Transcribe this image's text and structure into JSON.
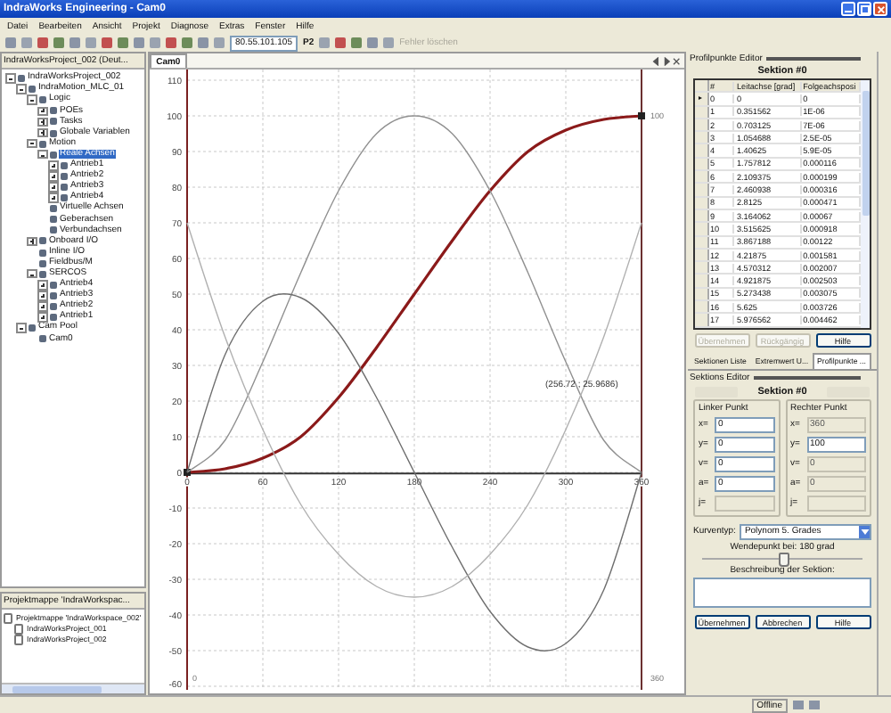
{
  "window": {
    "title": "IndraWorks Engineering - Cam0"
  },
  "menu": [
    "Datei",
    "Bearbeiten",
    "Ansicht",
    "Projekt",
    "Diagnose",
    "Extras",
    "Fenster",
    "Hilfe"
  ],
  "toolbar": {
    "address": "80.55.101.105",
    "p_label": "P2",
    "clear_button": {
      "label": "Fehler löschen",
      "disabled": true
    }
  },
  "project_panel": {
    "title": "IndraWorksProject_002 (Deut...",
    "tree": [
      {
        "label": "IndraWorksProject_002",
        "expanded": true,
        "selected": false,
        "children": [
          {
            "label": "IndraMotion_MLC_01",
            "expanded": true,
            "selected": false,
            "children": [
              {
                "label": "Logic",
                "expanded": true,
                "selected": false,
                "children": [
                  {
                    "label": "POEs",
                    "expanded": false,
                    "selected": false
                  },
                  {
                    "label": "Tasks",
                    "expanded": false,
                    "selected": false
                  },
                  {
                    "label": "Globale Variablen",
                    "expanded": false,
                    "selected": false
                  }
                ]
              },
              {
                "label": "Motion",
                "expanded": true,
                "selected": false,
                "children": [
                  {
                    "label": "Reale Achsen",
                    "expanded": true,
                    "selected": true,
                    "children": [
                      {
                        "label": "Antrieb1",
                        "expanded": false,
                        "selected": false
                      },
                      {
                        "label": "Antrieb2",
                        "expanded": false,
                        "selected": false
                      },
                      {
                        "label": "Antrieb3",
                        "expanded": false,
                        "selected": false
                      },
                      {
                        "label": "Antrieb4",
                        "expanded": false,
                        "selected": false
                      }
                    ]
                  },
                  {
                    "label": "Virtuelle Achsen",
                    "selected": false
                  },
                  {
                    "label": "Geberachsen",
                    "selected": false
                  },
                  {
                    "label": "Verbundachsen",
                    "selected": false
                  }
                ]
              },
              {
                "label": "Onboard I/O",
                "expanded": false,
                "selected": false
              },
              {
                "label": "Inline I/O",
                "selected": false
              },
              {
                "label": "Fieldbus/M",
                "selected": false
              },
              {
                "label": "SERCOS",
                "expanded": true,
                "selected": false,
                "children": [
                  {
                    "label": "Antrieb4",
                    "expanded": false,
                    "selected": false
                  },
                  {
                    "label": "Antrieb3",
                    "expanded": false,
                    "selected": false
                  },
                  {
                    "label": "Antrieb2",
                    "expanded": false,
                    "selected": false
                  },
                  {
                    "label": "Antrieb1",
                    "expanded": false,
                    "selected": false
                  }
                ]
              }
            ]
          },
          {
            "label": "Cam Pool",
            "expanded": true,
            "selected": false,
            "children": [
              {
                "label": "Cam0",
                "selected": false
              }
            ]
          }
        ]
      }
    ]
  },
  "solution_panel": {
    "title": "Projektmappe 'IndraWorkspac...",
    "tree": [
      {
        "label": "Projektmappe 'IndraWorkspace_002'",
        "selected": false,
        "children": [
          {
            "label": "IndraWorksProject_001",
            "selected": false
          },
          {
            "label": "IndraWorksProject_002",
            "selected": false
          }
        ]
      }
    ]
  },
  "editor_tab": {
    "label": "Cam0"
  },
  "chart_data": {
    "type": "line",
    "grid": true,
    "x": [
      0,
      30,
      60,
      90,
      120,
      150,
      180,
      210,
      240,
      270,
      300,
      330,
      360
    ],
    "series": [
      {
        "color": "#8b1a1a",
        "values": [
          0,
          1,
          4,
          10,
          21,
          35,
          50,
          65,
          79,
          90,
          96,
          99,
          100
        ]
      },
      {
        "color": "#909090",
        "values": [
          0,
          9,
          31,
          56,
          79,
          95,
          100,
          95,
          79,
          56,
          31,
          9,
          0
        ]
      },
      {
        "color": "#6e6e6e",
        "values": [
          0,
          33,
          48,
          49,
          39,
          21,
          0,
          -21,
          -39,
          -49,
          -48,
          -33,
          0
        ]
      },
      {
        "color": "#b0b0b0",
        "values": [
          70,
          38,
          12,
          -9,
          -23,
          -32,
          -35,
          -32,
          -23,
          -9,
          12,
          38,
          70
        ]
      }
    ],
    "xlim": [
      0,
      360
    ],
    "ylim": [
      -61,
      113
    ],
    "ref_lines": [
      {
        "axis": "x",
        "value": 360
      }
    ],
    "xticks": [
      0,
      60,
      120,
      180,
      240,
      300,
      360
    ],
    "yticks": [
      -60,
      -50,
      -40,
      -30,
      -20,
      -10,
      0,
      10,
      20,
      30,
      40,
      50,
      60,
      70,
      80,
      90,
      100,
      110
    ]
  },
  "chart_labels": {
    "readout": "(256.72 ; 25.9686)",
    "end_value": "100",
    "range_start": "0",
    "range_end": "360"
  },
  "profile_editor": {
    "title": "Profilpunkte Editor",
    "section": "Sektion #0",
    "columns": [
      "#",
      "Leitachse [grad]",
      "Folgeachsposi"
    ],
    "rows": [
      {
        "current": true,
        "cells": [
          "0",
          "0",
          "0"
        ]
      },
      {
        "current": false,
        "cells": [
          "1",
          "0.351562",
          "1E-06"
        ]
      },
      {
        "current": false,
        "cells": [
          "2",
          "0.703125",
          "7E-06"
        ]
      },
      {
        "current": false,
        "cells": [
          "3",
          "1.054688",
          "2.5E-05"
        ]
      },
      {
        "current": false,
        "cells": [
          "4",
          "1.40625",
          "5.9E-05"
        ]
      },
      {
        "current": false,
        "cells": [
          "5",
          "1.757812",
          "0.000116"
        ]
      },
      {
        "current": false,
        "cells": [
          "6",
          "2.109375",
          "0.000199"
        ]
      },
      {
        "current": false,
        "cells": [
          "7",
          "2.460938",
          "0.000316"
        ]
      },
      {
        "current": false,
        "cells": [
          "8",
          "2.8125",
          "0.000471"
        ]
      },
      {
        "current": false,
        "cells": [
          "9",
          "3.164062",
          "0.00067"
        ]
      },
      {
        "current": false,
        "cells": [
          "10",
          "3.515625",
          "0.000918"
        ]
      },
      {
        "current": false,
        "cells": [
          "11",
          "3.867188",
          "0.00122"
        ]
      },
      {
        "current": false,
        "cells": [
          "12",
          "4.21875",
          "0.001581"
        ]
      },
      {
        "current": false,
        "cells": [
          "13",
          "4.570312",
          "0.002007"
        ]
      },
      {
        "current": false,
        "cells": [
          "14",
          "4.921875",
          "0.002503"
        ]
      },
      {
        "current": false,
        "cells": [
          "15",
          "5.273438",
          "0.003075"
        ]
      },
      {
        "current": false,
        "cells": [
          "16",
          "5.625",
          "0.003726"
        ]
      },
      {
        "current": false,
        "cells": [
          "17",
          "5.976562",
          "0.004462"
        ]
      }
    ],
    "buttons": [
      {
        "label": "Übernehmen",
        "disabled": true
      },
      {
        "label": "Rückgängig",
        "disabled": true
      },
      {
        "label": "Hilfe",
        "disabled": false
      }
    ]
  },
  "tabs": [
    {
      "label": "Sektionen Liste",
      "selected": false
    },
    {
      "label": "Extremwert U...",
      "selected": false
    },
    {
      "label": "Profilpunkte ...",
      "selected": true
    }
  ],
  "section_editor": {
    "title": "Sektions Editor",
    "section": "Sektion #0",
    "groups": [
      {
        "title": "Linker Punkt",
        "fields": [
          {
            "label": "x=",
            "value": "0",
            "disabled": false
          },
          {
            "label": "y=",
            "value": "0",
            "disabled": false
          },
          {
            "label": "v=",
            "value": "0",
            "disabled": false
          },
          {
            "label": "a=",
            "value": "0",
            "disabled": false
          },
          {
            "label": "j=",
            "disabled": true
          }
        ]
      },
      {
        "title": "Rechter Punkt",
        "fields": [
          {
            "label": "x=",
            "value": "360",
            "disabled": true
          },
          {
            "label": "y=",
            "value": "100",
            "disabled": false
          },
          {
            "label": "v=",
            "value": "0",
            "disabled": true
          },
          {
            "label": "a=",
            "value": "0",
            "disabled": true
          },
          {
            "label": "j=",
            "disabled": true
          }
        ]
      }
    ],
    "curve_type_label": "Kurventyp:",
    "curve_type": "Polynom 5. Grades",
    "inflection": "Wendepunkt bei:  180 grad",
    "slider": {
      "level": 0.5
    },
    "description_label": "Beschreibung der Sektion:",
    "buttons": [
      {
        "label": "Übernehmen",
        "disabled": false
      },
      {
        "label": "Abbrechen",
        "disabled": false
      },
      {
        "label": "Hilfe",
        "disabled": false
      }
    ]
  },
  "status_bar": {
    "mode": "Offline"
  }
}
